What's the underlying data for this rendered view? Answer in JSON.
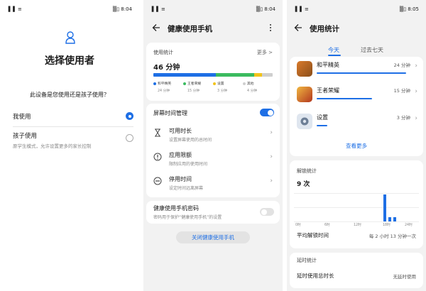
{
  "status_bars": [
    {
      "left": "▐▐ ≡",
      "right": "▒▯ 8:04"
    },
    {
      "left": "▐▐ ≡",
      "right": "▒▯ 8:04"
    },
    {
      "left": "▐▐ ≡",
      "right": "▒▯ 8:05"
    }
  ],
  "screen1": {
    "title": "选择使用者",
    "question": "此设备是您使用还是孩子使用？",
    "option_me": {
      "label": "我使用",
      "selected": true
    },
    "option_child": {
      "label": "孩子使用",
      "description": "原学生模式，允许设置更多的家长控制",
      "selected": false
    }
  },
  "screen2": {
    "title": "健康使用手机",
    "usage_label": "使用统计",
    "more_label": "更多 >",
    "total_time": "46 分钟",
    "usage_bar": [
      {
        "name": "和平精英",
        "minutes": "24 分钟",
        "color": "#1e6fe5",
        "value": 24
      },
      {
        "name": "王者荣耀",
        "minutes": "15 分钟",
        "color": "#3bbb5f",
        "value": 15
      },
      {
        "name": "设置",
        "minutes": "3 分钟",
        "color": "#f2c31a",
        "value": 3
      },
      {
        "name": "其他",
        "minutes": "4 分钟",
        "color": "#cfcfcf",
        "value": 4
      }
    ],
    "screen_time_label": "屏幕时间管理",
    "screen_time_enabled": true,
    "menu": [
      {
        "icon": "hourglass-icon",
        "title": "可用时长",
        "description": "设置屏幕使用的总时间"
      },
      {
        "icon": "app-limit-icon",
        "title": "应用限额",
        "description": "限制应用的使用时间"
      },
      {
        "icon": "downtime-icon",
        "title": "停用时间",
        "description": "设定时间远离屏幕"
      }
    ],
    "password_title": "健康使用手机密码",
    "password_desc": "密码用于保护“健康使用手机”的设置",
    "password_enabled": false,
    "close_button": "关闭健康使用手机"
  },
  "screen3": {
    "title": "使用统计",
    "tabs": [
      "今天",
      "过去七天"
    ],
    "active_tab": 0,
    "apps": [
      {
        "name": "和平精英",
        "time": "24 分钟",
        "fraction": 1.0
      },
      {
        "name": "王者荣耀",
        "time": "15 分钟",
        "fraction": 0.62
      },
      {
        "name": "设置",
        "time": "3 分钟",
        "fraction": 0.12
      }
    ],
    "see_more": "查看更多",
    "unlock_label": "解锁统计",
    "unlock_count": "9 次",
    "unlock_chart": {
      "x_ticks": [
        "0时",
        "6时",
        "12时",
        "18时",
        "24时"
      ],
      "hourly": [
        0,
        0,
        0,
        0,
        0,
        0,
        0,
        0,
        0,
        0,
        0,
        0,
        0,
        0,
        0,
        0,
        0,
        0,
        6,
        1,
        1,
        0,
        0,
        0
      ]
    },
    "avg_label": "平均解锁时间",
    "avg_value": "每 2 小时 13 分钟一次",
    "delay_label": "延时统计",
    "delay_title": "延时使用总时长",
    "delay_value": "无延时使用"
  }
}
